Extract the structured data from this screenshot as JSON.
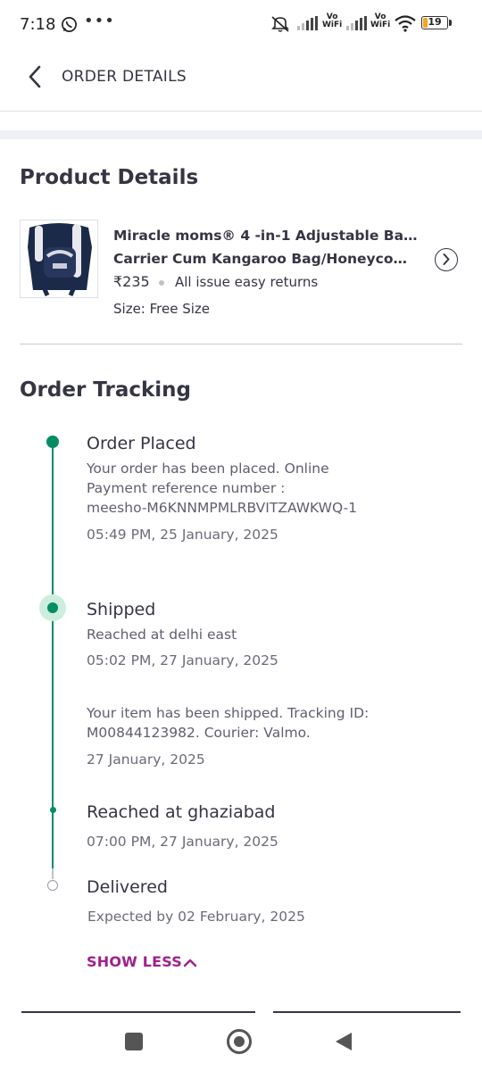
{
  "status_bar": {
    "time": "7:18",
    "battery": "19",
    "vowifi_top": "Vo",
    "vowifi_bottom": "WiFi",
    "more": "•••"
  },
  "header": {
    "title": "ORDER DETAILS"
  },
  "product": {
    "section_title": "Product Details",
    "name_line1": "Miracle moms®  4 -in-1 Adjustable Baby",
    "name_line2": "Carrier Cum Kangaroo Bag/Honeycomb...",
    "price": "₹235",
    "returns": "All issue easy returns",
    "size": "Size: Free Size"
  },
  "tracking": {
    "section_title": "Order Tracking",
    "steps": [
      {
        "title": "Order Placed",
        "text_line1": "Your order has been placed. Online",
        "text_line2": "Payment reference number :",
        "text_line3": "meesho-M6KNNMPMLRBVITZAWKWQ-1",
        "date": "05:49 PM, 25 January, 2025"
      },
      {
        "title": "Shipped",
        "text_line1": "Reached at delhi east",
        "date": "05:02 PM, 27 January, 2025",
        "sub_text_line1": "Your item has been shipped. Tracking ID:",
        "sub_text_line2": "M00844123982. Courier: Valmo.",
        "sub_date": "27 January, 2025"
      },
      {
        "title": "Reached at ghaziabad",
        "date": "07:00 PM, 27 January, 2025"
      },
      {
        "title": "Delivered",
        "date": "Expected by 02 February, 2025"
      }
    ],
    "toggle_label": "SHOW LESS"
  },
  "colors": {
    "accent": "#9f2089",
    "track_green": "#038d63",
    "text": "#353543"
  }
}
